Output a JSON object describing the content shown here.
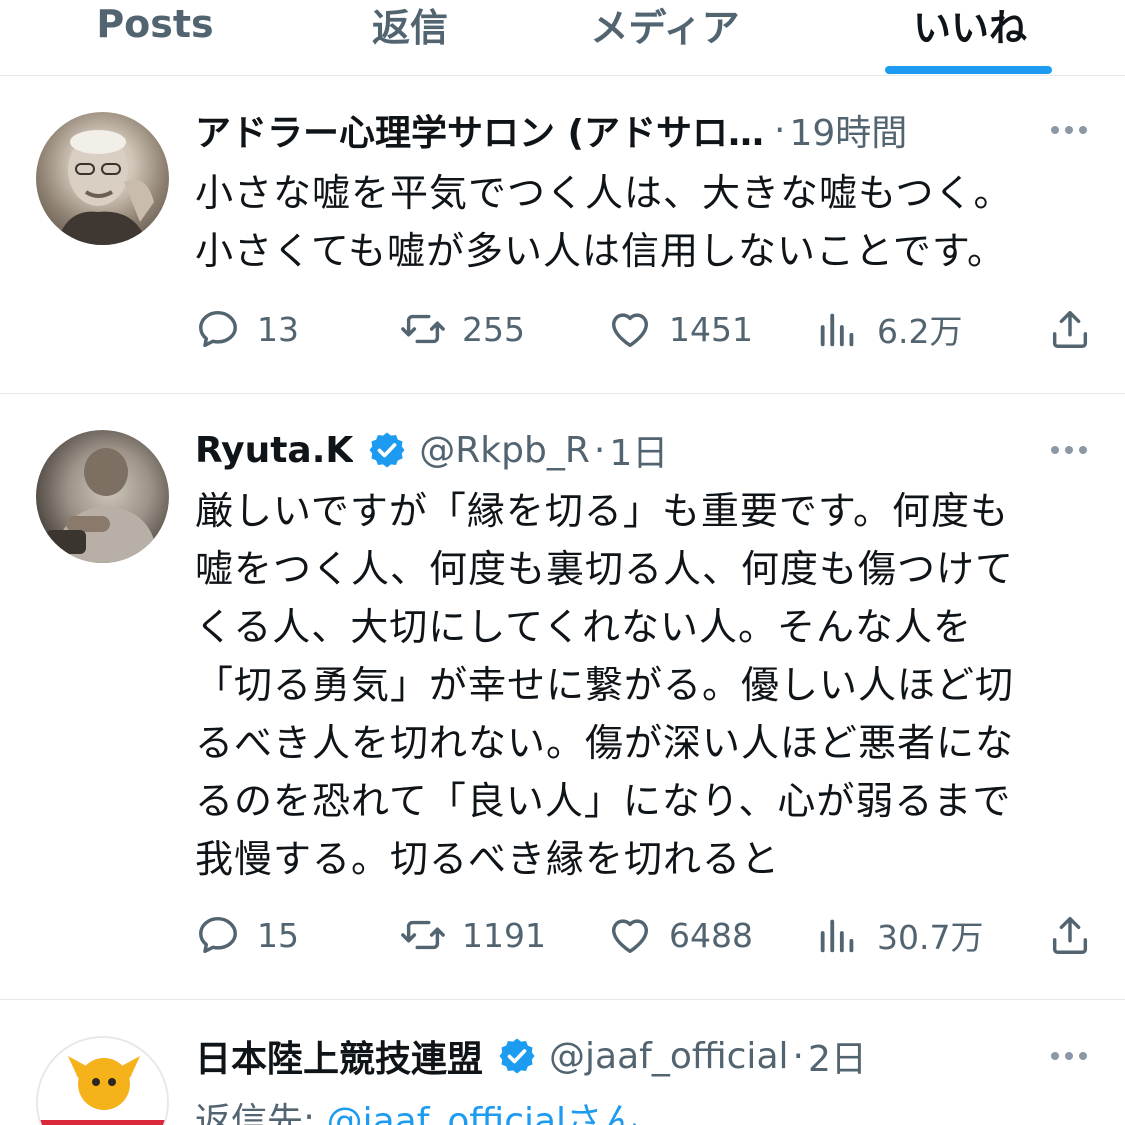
{
  "tabs": [
    {
      "label": "Posts",
      "active": false
    },
    {
      "label": "返信",
      "active": false
    },
    {
      "label": "メディア",
      "active": false
    },
    {
      "label": "いいね",
      "active": true
    }
  ],
  "posts": [
    {
      "name": "アドラー心理学サロン (アドサロ…",
      "verified": false,
      "handle": "",
      "time": "19時間",
      "body": [
        "小さな嘘を平気でつく人は、大きな嘘もつく。",
        "小さくても嘘が多い人は信用しないことです。"
      ],
      "replies": "13",
      "reposts": "255",
      "likes": "1451",
      "views": "6.2万"
    },
    {
      "name": "Ryuta.K",
      "verified": true,
      "handle": "@Rkpb_R",
      "time": "1日",
      "body": [
        "厳しいですが「縁を切る」も重要です。何度も",
        "嘘をつく人、何度も裏切る人、何度も傷つけて",
        "くる人、大切にしてくれない人。そんな人を",
        "「切る勇気」が幸せに繋がる。優しい人ほど切",
        "るべき人を切れない。傷が深い人ほど悪者にな",
        "るのを恐れて「良い人」になり、心が弱るまで",
        "我慢する。切るべき縁を切れると"
      ],
      "replies": "15",
      "reposts": "1191",
      "likes": "6488",
      "views": "30.7万"
    },
    {
      "name": "日本陸上競技連盟",
      "verified": true,
      "handle": "@jaaf_official",
      "time": "2日",
      "reply_to_prefix": "返信先: ",
      "reply_to_handle": "@jaaf_official",
      "reply_to_suffix": "さん"
    }
  ],
  "separator": "·",
  "colors": {
    "accent": "#1d9bf0",
    "text": "#0f1419",
    "muted": "#536471",
    "divider": "#e6e9ec"
  },
  "icons": [
    "reply-icon",
    "repost-icon",
    "like-icon",
    "views-icon",
    "share-icon",
    "more-icon",
    "verified-badge-icon"
  ]
}
